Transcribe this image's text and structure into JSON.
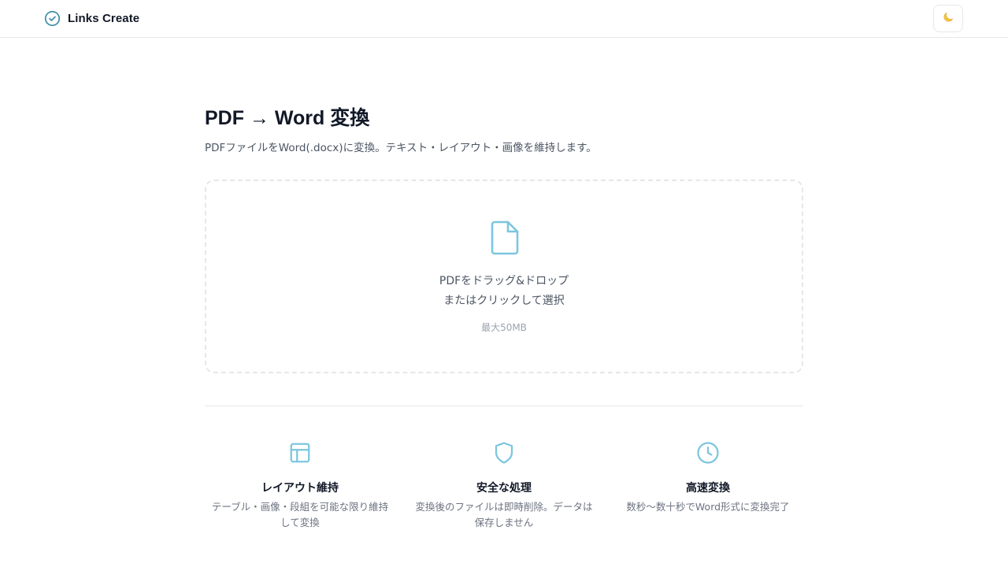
{
  "header": {
    "brand_name": "Links Create",
    "brand_icon": "check-circle-icon",
    "theme_toggle_icon": "moon-icon",
    "theme_toggle_glyph": "🌙"
  },
  "main": {
    "title": "PDF → Word 変換",
    "subtitle": "PDFファイルをWord(.docx)に変換。テキスト・レイアウト・画像を維持します。",
    "dropzone": {
      "icon": "file-icon",
      "line1": "PDFをドラッグ&ドロップ",
      "line2": "またはクリックして選択",
      "limit": "最大50MB"
    }
  },
  "features": [
    {
      "icon": "layout-icon",
      "title": "レイアウト維持",
      "description": "テーブル・画像・段組を可能な限り維持して変換"
    },
    {
      "icon": "shield-icon",
      "title": "安全な処理",
      "description": "変換後のファイルは即時削除。データは保存しません"
    },
    {
      "icon": "clock-icon",
      "title": "高速変換",
      "description": "数秒〜数十秒でWord形式に変換完了"
    }
  ],
  "colors": {
    "accent": "#7cc6df",
    "brand_icon": "#3f8fa6",
    "text_primary": "#111827",
    "text_secondary": "#4b5563",
    "text_muted": "#9ca3af",
    "border": "#e5e7eb"
  }
}
